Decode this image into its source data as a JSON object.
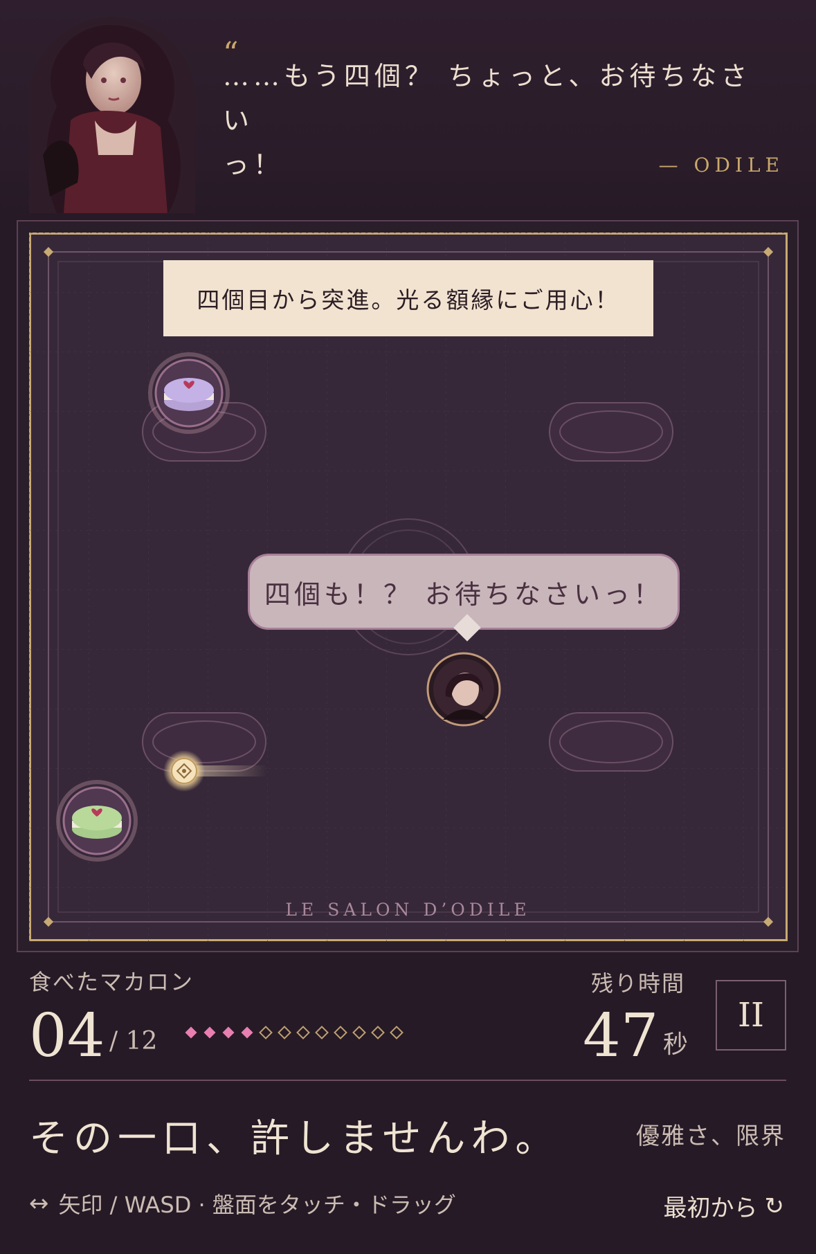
{
  "header": {
    "quote_mark": "“",
    "quote_line1": "……もう四個？ ちょっと、お待ちなさい",
    "quote_line2": "っ！",
    "author": "— ODILE"
  },
  "board": {
    "hint": "四個目から突進。光る額縁にご用心！",
    "speech": "四個も！？ お待ちなさいっ！",
    "label": "LE SALON D’ODILE",
    "macarons": [
      {
        "color": "lavender"
      },
      {
        "color": "pistachio"
      }
    ]
  },
  "hud": {
    "eaten_label": "食べたマカロン",
    "eaten_count": "04",
    "eaten_total": "/ 12",
    "pips_total": 12,
    "pips_filled": 4,
    "pip_filled_color": "#e87fb0",
    "pip_empty_color": "#bfa173",
    "time_label": "残り時間",
    "time_value": "47",
    "time_unit": "秒",
    "pause_label": "II"
  },
  "footer": {
    "taunt": "その一口、許しませんわ。",
    "grace": "優雅さ、限界",
    "controls_icon": "↔",
    "controls": "矢印 / WASD · 盤面をタッチ・ドラッグ",
    "restart_label": "最初から",
    "restart_icon": "↻"
  }
}
